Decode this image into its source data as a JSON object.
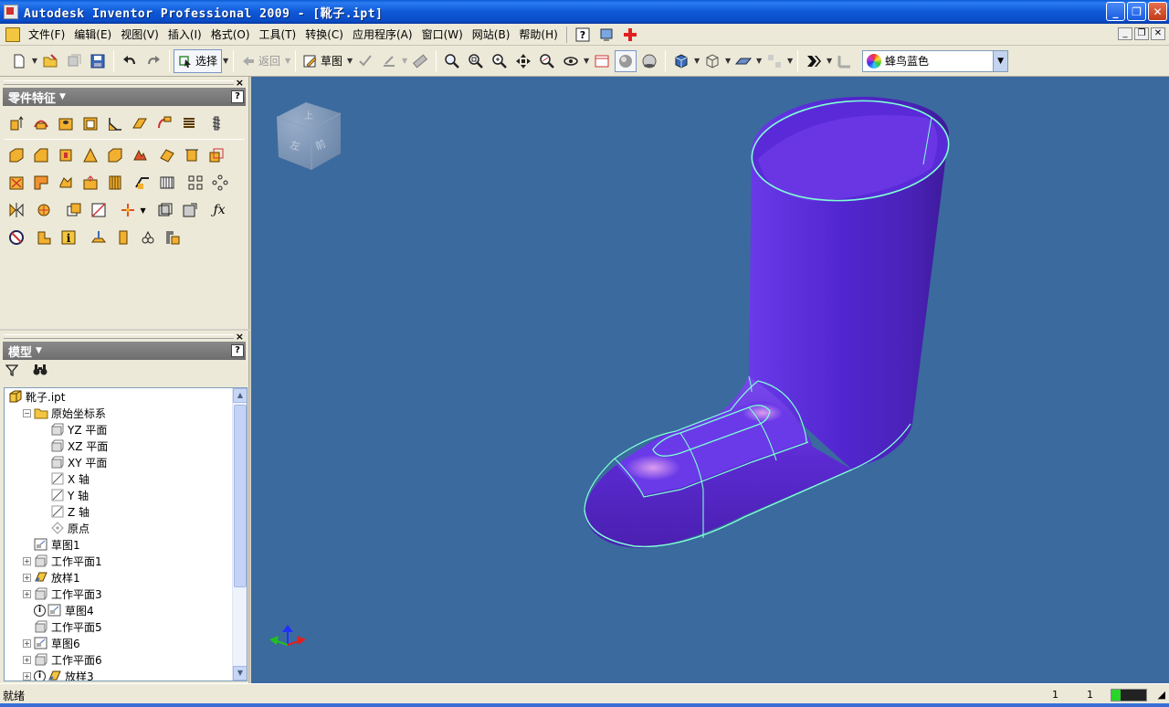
{
  "window": {
    "title": "Autodesk Inventor Professional 2009 - [靴子.ipt]",
    "controls": {
      "minimize": "_",
      "maximize": "❐",
      "close": "✕"
    }
  },
  "menu": {
    "items": [
      "文件(F)",
      "编辑(E)",
      "视图(V)",
      "插入(I)",
      "格式(O)",
      "工具(T)",
      "转换(C)",
      "应用程序(A)",
      "窗口(W)",
      "网站(B)",
      "帮助(H)"
    ],
    "mdi_controls": [
      "_",
      "❐",
      "✕"
    ]
  },
  "toolbar": {
    "select_label": "选择",
    "return_label": "返回",
    "sketch_label": "草图",
    "color_combo_value": "蜂鸟蓝色"
  },
  "feature_panel": {
    "title": "零件特征",
    "help": "?",
    "close": "×"
  },
  "model_panel": {
    "title": "模型",
    "help": "?",
    "close": "×"
  },
  "model_tree": [
    {
      "label": "靴子.ipt",
      "icon": "part-icon",
      "level": 0,
      "expander": "none"
    },
    {
      "label": "原始坐标系",
      "icon": "folder-icon",
      "level": 1,
      "expander": "-"
    },
    {
      "label": "YZ 平面",
      "icon": "work-plane-icon",
      "level": 2,
      "expander": "none"
    },
    {
      "label": "XZ 平面",
      "icon": "work-plane-icon",
      "level": 2,
      "expander": "none"
    },
    {
      "label": "XY 平面",
      "icon": "work-plane-icon",
      "level": 2,
      "expander": "none"
    },
    {
      "label": "X 轴",
      "icon": "work-axis-icon",
      "level": 2,
      "expander": "none"
    },
    {
      "label": "Y 轴",
      "icon": "work-axis-icon",
      "level": 2,
      "expander": "none"
    },
    {
      "label": "Z 轴",
      "icon": "work-axis-icon",
      "level": 2,
      "expander": "none"
    },
    {
      "label": "原点",
      "icon": "work-point-icon",
      "level": 2,
      "expander": "none"
    },
    {
      "label": "草图1",
      "icon": "sketch-icon",
      "level": 1,
      "expander": "none"
    },
    {
      "label": "工作平面1",
      "icon": "work-plane-icon",
      "level": 1,
      "expander": "+"
    },
    {
      "label": "放样1",
      "icon": "loft-icon",
      "level": 1,
      "expander": "+"
    },
    {
      "label": "工作平面3",
      "icon": "work-plane-icon",
      "level": 1,
      "expander": "+"
    },
    {
      "label": "草图4",
      "icon": "sketch-icon",
      "level": 1,
      "expander": "info"
    },
    {
      "label": "工作平面5",
      "icon": "work-plane-icon",
      "level": 1,
      "expander": "none"
    },
    {
      "label": "草图6",
      "icon": "sketch-icon",
      "level": 1,
      "expander": "+"
    },
    {
      "label": "工作平面6",
      "icon": "work-plane-icon",
      "level": 1,
      "expander": "+"
    },
    {
      "label": "放样3",
      "icon": "loft-icon",
      "level": 1,
      "expander": "+info"
    }
  ],
  "statusbar": {
    "text": "就绪",
    "count1": "1",
    "count2": "1"
  },
  "colors": {
    "viewport_bg": "#3b6a9e",
    "model_body": "#5a2ad0",
    "model_edge": "#7fffd4"
  }
}
